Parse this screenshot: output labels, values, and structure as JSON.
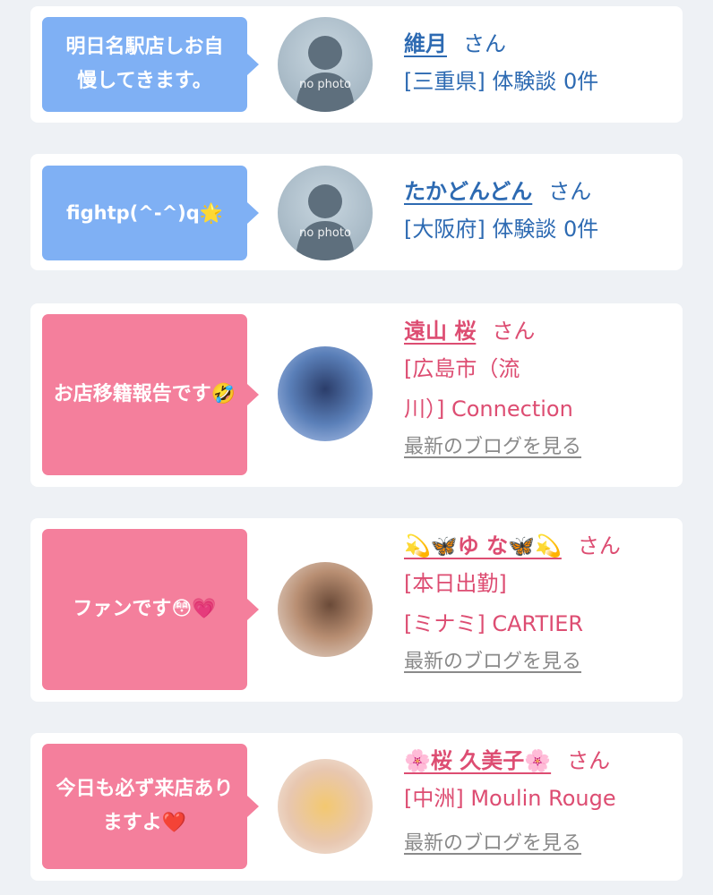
{
  "entries": [
    {
      "message": "明日名駅店しお自慢してきます。",
      "avatar": {
        "type": "no-photo",
        "label": "no photo"
      },
      "name": "維月",
      "honorific": "さん",
      "meta_lines": [
        "[三重県] 体験談 0件"
      ],
      "blog_link": ""
    },
    {
      "message": "fightp(^-^)q🌟",
      "avatar": {
        "type": "no-photo",
        "label": "no photo"
      },
      "name": "たかどんどん",
      "honorific": "さん",
      "meta_lines": [
        "[大阪府] 体験談 0件"
      ],
      "blog_link": ""
    },
    {
      "message": "お店移籍報告です🤣",
      "avatar": {
        "type": "photo"
      },
      "name": "遠山 桜",
      "honorific": "さん",
      "meta_lines": [
        "[広島市（流",
        "川）] Connection"
      ],
      "blog_link": "最新のブログを見る"
    },
    {
      "message": "ファンです😳💗",
      "avatar": {
        "type": "photo"
      },
      "name": "💫🦋ゆ な🦋💫",
      "honorific": "さん",
      "meta_lines": [
        "[本日出勤]",
        "[ミナミ] CARTIER"
      ],
      "blog_link": "最新のブログを見る"
    },
    {
      "message": "今日も必ず来店ありますよ❤️",
      "avatar": {
        "type": "photo"
      },
      "name": "🌸桜 久美子🌸",
      "honorific": "さん",
      "meta_lines": [
        "[中洲] Moulin Rouge"
      ],
      "blog_link": "最新のブログを見る"
    }
  ],
  "colors": {
    "blue_bubble": "#7fb0f4",
    "pink_bubble": "#f47f9c",
    "blue_text": "#2d6ab2",
    "pink_text": "#dd4d72",
    "background": "#eef1f5"
  }
}
